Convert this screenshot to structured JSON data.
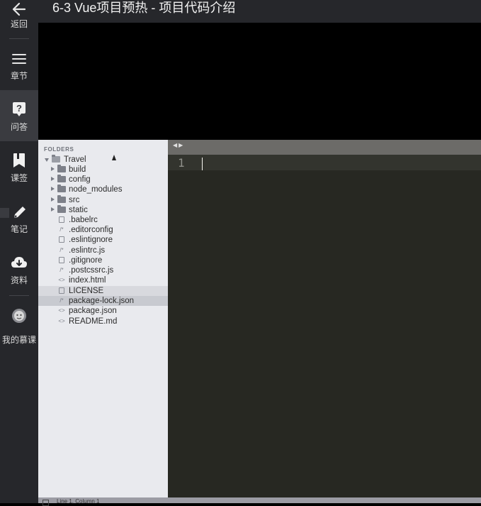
{
  "header": {
    "title": "6-3 Vue项目预热 - 项目代码介绍"
  },
  "nav": {
    "back": "返回",
    "chapters": "章节",
    "qa": "问答",
    "bookmarks": "课签",
    "notes": "笔记",
    "materials": "资料",
    "my_courses": "我的慕课"
  },
  "sidebar": {
    "folders_label": "FOLDERS",
    "root": "Travel",
    "items": [
      {
        "label": "build",
        "kind": "folder"
      },
      {
        "label": "config",
        "kind": "folder"
      },
      {
        "label": "node_modules",
        "kind": "folder"
      },
      {
        "label": "src",
        "kind": "folder"
      },
      {
        "label": "static",
        "kind": "folder"
      },
      {
        "label": ".babelrc",
        "kind": "file"
      },
      {
        "label": ".editorconfig",
        "kind": "comment-file"
      },
      {
        "label": ".eslintignore",
        "kind": "file"
      },
      {
        "label": ".eslintrc.js",
        "kind": "comment-file"
      },
      {
        "label": ".gitignore",
        "kind": "file"
      },
      {
        "label": ".postcssrc.js",
        "kind": "comment-file"
      },
      {
        "label": "index.html",
        "kind": "code-file"
      },
      {
        "label": "LICENSE",
        "kind": "file"
      },
      {
        "label": "package-lock.json",
        "kind": "comment-file"
      },
      {
        "label": "package.json",
        "kind": "code-file"
      },
      {
        "label": "README.md",
        "kind": "code-file"
      }
    ]
  },
  "editor": {
    "line_number": "1"
  },
  "statusbar": {
    "text": "Line 1, Column 1"
  },
  "colors": {
    "nav_bg": "#26272b",
    "sidebar_bg": "#e9eaee",
    "editor_bg": "#272822"
  }
}
